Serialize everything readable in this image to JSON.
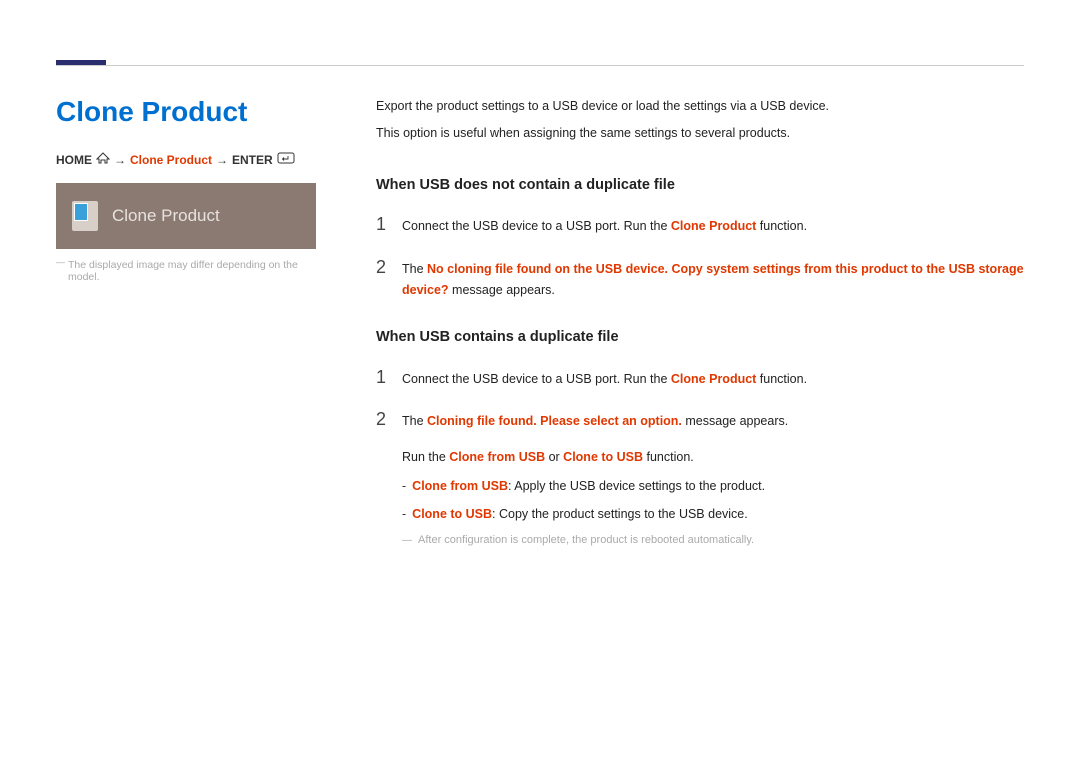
{
  "pageTitle": "Clone Product",
  "breadcrumb": {
    "home": "HOME",
    "current": "Clone Product",
    "enter": "ENTER",
    "arrow": "→"
  },
  "tile": {
    "label": "Clone Product"
  },
  "caption": "The displayed image may differ depending on the model.",
  "intro": {
    "line1": "Export the product settings to a USB device or load the settings via a USB device.",
    "line2": "This option is useful when assigning the same settings to several products."
  },
  "section1": {
    "heading": "When USB does not contain a duplicate file",
    "step1": {
      "pre": "Connect the USB device to a USB port. Run the ",
      "kw": "Clone Product",
      "post": " function."
    },
    "step2": {
      "pre": "The ",
      "kw": "No cloning file found on the USB device. Copy system settings from this product to the USB storage device?",
      "post": " message appears."
    }
  },
  "section2": {
    "heading": "When USB contains a duplicate file",
    "step1": {
      "pre": "Connect the USB device to a USB port. Run the ",
      "kw": "Clone Product",
      "post": " function."
    },
    "step2": {
      "pre": "The ",
      "kw": "Cloning file found. Please select an option.",
      "post": " message appears."
    },
    "run": {
      "pre": "Run the ",
      "kw1": "Clone from USB",
      "mid": " or ",
      "kw2": "Clone to USB",
      "post": " function."
    },
    "opt1": {
      "kw": "Clone from USB",
      "desc": ": Apply the USB device settings to the product."
    },
    "opt2": {
      "kw": "Clone to USB",
      "desc": ": Copy the product settings to the USB device."
    },
    "note": "After configuration is complete, the product is rebooted automatically."
  }
}
